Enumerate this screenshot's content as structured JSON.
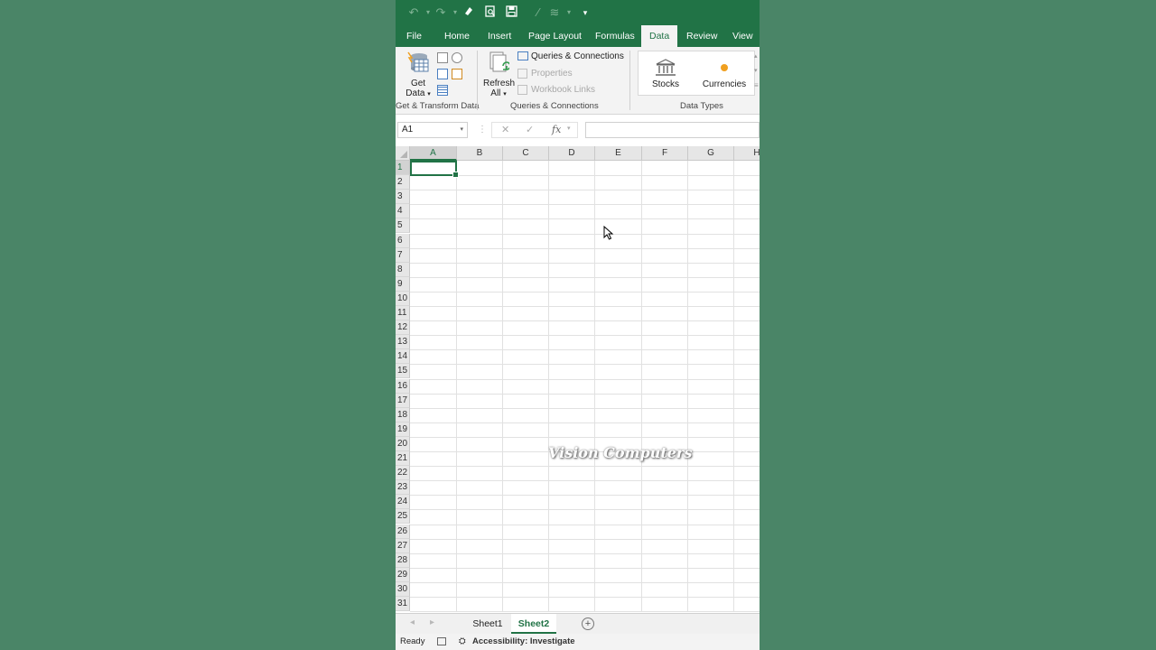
{
  "quick_access": {
    "icons": [
      "undo-icon",
      "redo-icon",
      "eraser-icon",
      "print-preview-icon",
      "save-icon",
      "format-painter-icon",
      "customize-icon"
    ]
  },
  "tabs": [
    "File",
    "Home",
    "Insert",
    "Page Layout",
    "Formulas",
    "Data",
    "Review",
    "View"
  ],
  "active_tab": "Data",
  "ribbon": {
    "get_data": {
      "line1": "Get",
      "line2": "Data"
    },
    "group1_label": "Get & Transform Data",
    "refresh_all": {
      "line1": "Refresh",
      "line2": "All"
    },
    "queries_connections": "Queries & Connections",
    "properties": "Properties",
    "workbook_links": "Workbook Links",
    "group2_label": "Queries & Connections",
    "stocks": "Stocks",
    "currencies": "Currencies",
    "group3_label": "Data Types"
  },
  "formula_bar": {
    "name_box": "A1",
    "fx": "fx",
    "formula": ""
  },
  "grid": {
    "columns": [
      "A",
      "B",
      "C",
      "D",
      "E",
      "F",
      "G",
      "H"
    ],
    "rows": [
      "1",
      "2",
      "3",
      "4",
      "5",
      "6",
      "7",
      "8",
      "9",
      "10",
      "11",
      "12",
      "13",
      "14",
      "15",
      "16",
      "17",
      "18",
      "19",
      "20",
      "21",
      "22",
      "23",
      "24",
      "25",
      "26",
      "27",
      "28",
      "29",
      "30",
      "31"
    ],
    "selected_cell": "A1",
    "watermark": "Vision Computers"
  },
  "sheets": [
    "Sheet1",
    "Sheet2"
  ],
  "active_sheet": "Sheet2",
  "status": {
    "ready": "Ready",
    "accessibility": "Accessibility: Investigate"
  },
  "colors": {
    "accent": "#217346",
    "background": "#4a8567"
  }
}
